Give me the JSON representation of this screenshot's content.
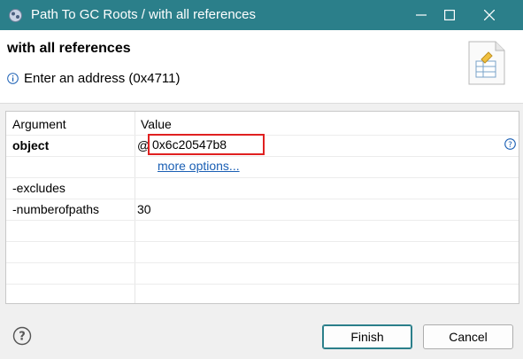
{
  "window": {
    "title": "Path To GC Roots / with all references",
    "title_bar_color": "#2b7f8a"
  },
  "header": {
    "heading": "with all references",
    "message": "Enter an address (0x4711)",
    "info_icon": "info-icon",
    "wizard_icon": "wizard-table-icon"
  },
  "table": {
    "columns": [
      "Argument",
      "Value"
    ],
    "rows": [
      {
        "argument": "object",
        "at_sign": "@",
        "value": "0x6c20547b8",
        "link": "more options..."
      },
      {
        "argument": "-excludes",
        "value": ""
      },
      {
        "argument": "-numberofpaths",
        "value": "30"
      }
    ]
  },
  "buttons": {
    "finish": "Finish",
    "cancel": "Cancel"
  },
  "colors": {
    "highlight_border": "#e02020",
    "link": "#1a5fb4"
  }
}
